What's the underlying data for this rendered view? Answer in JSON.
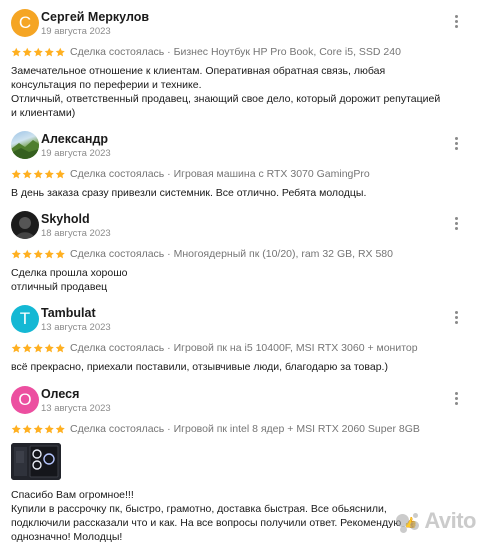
{
  "reviews": [
    {
      "author": "Сергей Меркулов",
      "date": "19 августа 2023",
      "avatar_letter": "С",
      "avatar_color": "#f5a524",
      "deal": "Сделка состоялась · Бизнес Ноутбук HP Pro Book, Core i5, SSD 240",
      "text": [
        "Замечательное отношение к клиентам. Оперативная обратная связь, любая консультация по переферии и технике.",
        "Отличный, ответственный продавец, знающий свое дело, который дорожит репутацией и клиентами)"
      ]
    },
    {
      "author": "Александр",
      "date": "19 августа 2023",
      "avatar_letter": "",
      "avatar_color": "#5a8b3a",
      "deal": "Сделка состоялась · Игровая машина с RTX 3070 GamingPro",
      "text": [
        "В день заказа сразу привезли системник. Все отлично. Ребята молодцы."
      ]
    },
    {
      "author": "Skyhold",
      "date": "18 августа 2023",
      "avatar_letter": "",
      "avatar_color": "#2a2a2a",
      "deal": "Сделка состоялась · Многоядерный пк (10/20), ram 32 GB, RX 580",
      "text": [
        "Сделка прошла хорошо",
        "отличный продавец"
      ]
    },
    {
      "author": "Tambulat",
      "date": "13 августа 2023",
      "avatar_letter": "T",
      "avatar_color": "#14b8d4",
      "deal": "Сделка состоялась · Игровой пк на i5 10400F, MSI RTX 3060 + монитор",
      "text": [
        "всё прекрасно, приехали поставили, отзывчивые люди, благодарю за товар.)"
      ]
    },
    {
      "author": "Олеся",
      "date": "13 августа 2023",
      "avatar_letter": "О",
      "avatar_color": "#ec4fa0",
      "deal": "Сделка состоялась · Игровой пк intel 8 ядер + MSI RTX 2060 Super 8GB",
      "text": [
        "Спасибо Вам огромное!!!",
        "Купили в рассрочку пк, быстро, грамотно, доставка быстрая. Все обьяснили, подключили рассказали что и как. На все вопросы получили ответ. Рекомендую 👍 однозначно! Молодцы!"
      ]
    }
  ],
  "star_color": "#ffb021",
  "rating": 5,
  "watermark": "Avito"
}
